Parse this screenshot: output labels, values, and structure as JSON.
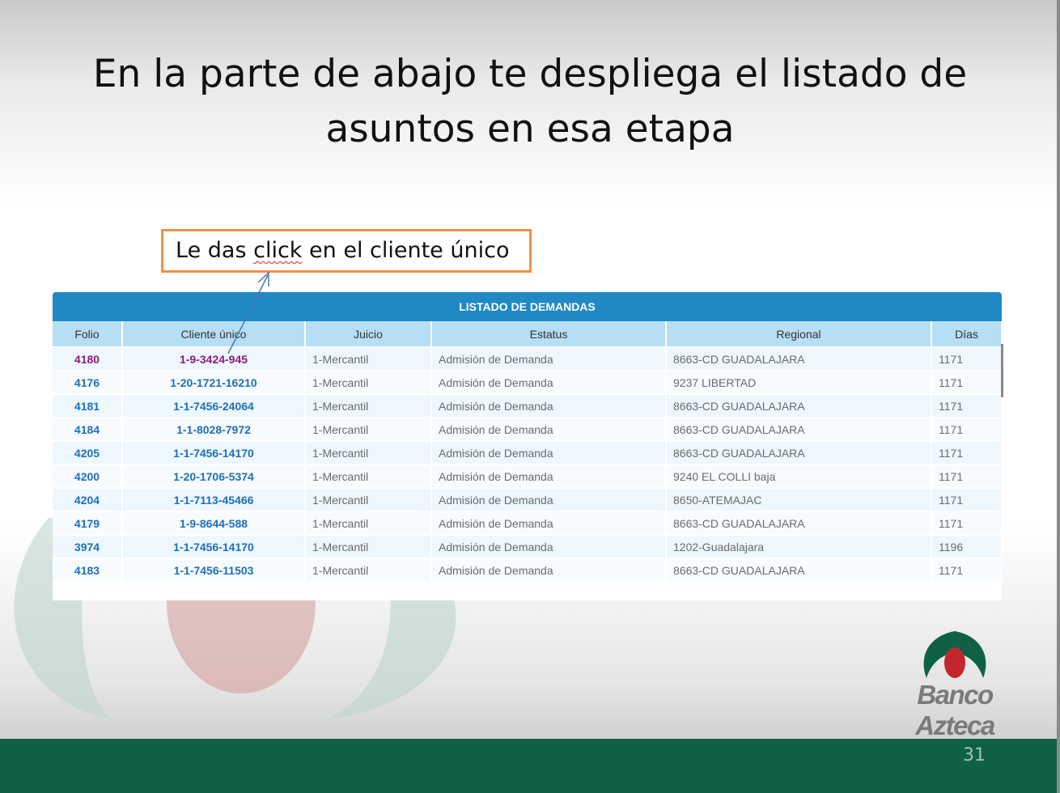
{
  "slide": {
    "title_line1": "En la parte de abajo te despliega el listado de",
    "title_line2": "asuntos en esa etapa",
    "page_number": "31"
  },
  "callout": {
    "prefix": "Le das ",
    "underlined": "click",
    "suffix": " en el cliente único"
  },
  "table": {
    "title": "LISTADO DE DEMANDAS",
    "columns": [
      "Folio",
      "Cliente único",
      "Juicio",
      "Estatus",
      "Regional",
      "Días"
    ],
    "rows": [
      {
        "folio": "4180",
        "cliente": "1-9-3424-945",
        "juicio": "1-Mercantil",
        "estatus": "Admisión de Demanda",
        "regional": "8663-CD GUADALAJARA",
        "dias": "1171"
      },
      {
        "folio": "4176",
        "cliente": "1-20-1721-16210",
        "juicio": "1-Mercantil",
        "estatus": "Admisión de Demanda",
        "regional": "9237 LIBERTAD",
        "dias": "1171"
      },
      {
        "folio": "4181",
        "cliente": "1-1-7456-24064",
        "juicio": "1-Mercantil",
        "estatus": "Admisión de Demanda",
        "regional": "8663-CD GUADALAJARA",
        "dias": "1171"
      },
      {
        "folio": "4184",
        "cliente": "1-1-8028-7972",
        "juicio": "1-Mercantil",
        "estatus": "Admisión de Demanda",
        "regional": "8663-CD GUADALAJARA",
        "dias": "1171"
      },
      {
        "folio": "4205",
        "cliente": "1-1-7456-14170",
        "juicio": "1-Mercantil",
        "estatus": "Admisión de Demanda",
        "regional": "8663-CD GUADALAJARA",
        "dias": "1171"
      },
      {
        "folio": "4200",
        "cliente": "1-20-1706-5374",
        "juicio": "1-Mercantil",
        "estatus": "Admisión de Demanda",
        "regional": "9240 EL COLLI baja",
        "dias": "1171"
      },
      {
        "folio": "4204",
        "cliente": "1-1-7113-45466",
        "juicio": "1-Mercantil",
        "estatus": "Admisión de Demanda",
        "regional": "8650-ATEMAJAC",
        "dias": "1171"
      },
      {
        "folio": "4179",
        "cliente": "1-9-8644-588",
        "juicio": "1-Mercantil",
        "estatus": "Admisión de Demanda",
        "regional": "8663-CD GUADALAJARA",
        "dias": "1171"
      },
      {
        "folio": "3974",
        "cliente": "1-1-7456-14170",
        "juicio": "1-Mercantil",
        "estatus": "Admisión de Demanda",
        "regional": "1202-Guadalajara",
        "dias": "1196"
      },
      {
        "folio": "4183",
        "cliente": "1-1-7456-11503",
        "juicio": "1-Mercantil",
        "estatus": "Admisión de Demanda",
        "regional": "8663-CD GUADALAJARA",
        "dias": "1171"
      }
    ]
  },
  "logo": {
    "text": "Banco Azteca"
  },
  "colors": {
    "header_blue": "#2089c4",
    "column_header": "#b6def5",
    "link_blue": "#1e6fb9",
    "visited_purple": "#8b1a7e",
    "callout_border": "#f0914a",
    "footer_green": "#0e6146",
    "logo_green": "#0e6146",
    "logo_red": "#c1272d"
  }
}
